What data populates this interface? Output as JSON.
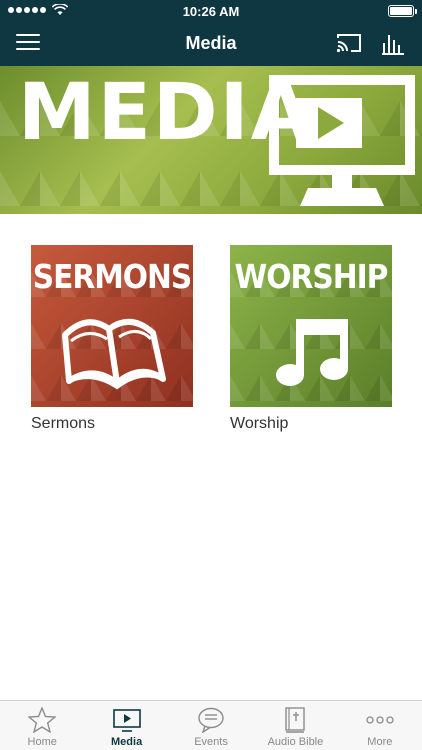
{
  "status_bar": {
    "time": "10:26 AM"
  },
  "nav": {
    "title": "Media"
  },
  "banner": {
    "title": "MEDIA"
  },
  "tiles": [
    {
      "image_text": "SERMONS",
      "label": "Sermons"
    },
    {
      "image_text": "WORSHIP",
      "label": "Worship"
    }
  ],
  "tabs": [
    {
      "label": "Home",
      "icon": "star-icon"
    },
    {
      "label": "Media",
      "icon": "play-screen-icon",
      "active": true
    },
    {
      "label": "Events",
      "icon": "chat-bubble-icon"
    },
    {
      "label": "Audio Bible",
      "icon": "bible-icon"
    },
    {
      "label": "More",
      "icon": "more-dots-icon"
    }
  ],
  "colors": {
    "header": "#0e3742",
    "accent_green": "#8ba93c",
    "sermons_red": "#b04a30"
  }
}
